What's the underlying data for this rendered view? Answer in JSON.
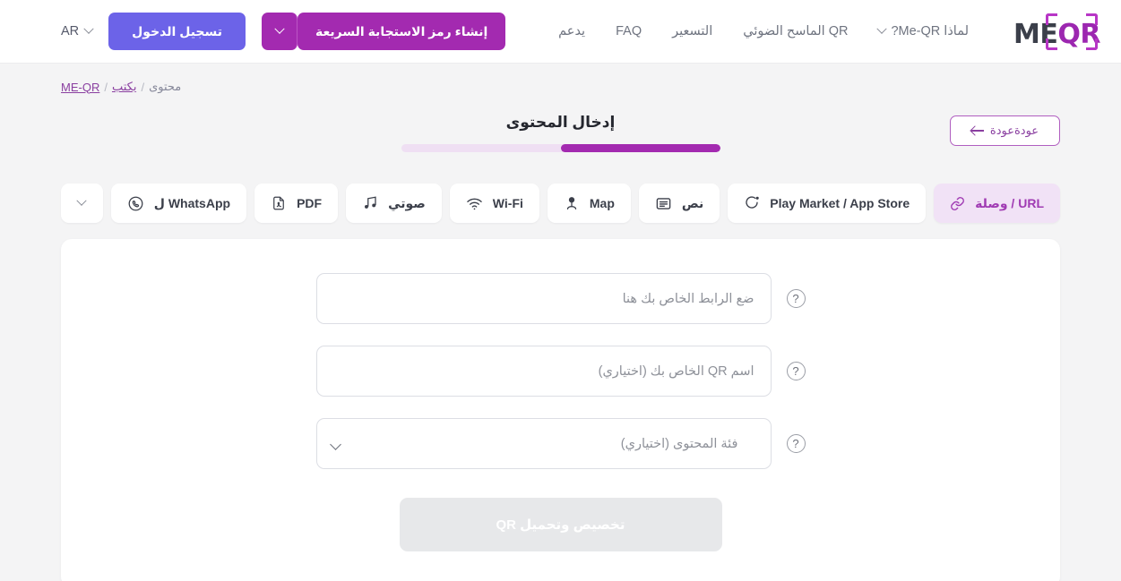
{
  "header": {
    "logo": {
      "primary": "ME",
      "accent": "QR",
      "alt": "ME-QR logo"
    },
    "nav": [
      {
        "label": "لماذا Me-QR?",
        "has_dropdown": true
      },
      {
        "label": "QR الماسح الضوئي",
        "has_dropdown": false
      },
      {
        "label": "التسعير",
        "has_dropdown": false
      },
      {
        "label": "FAQ",
        "has_dropdown": false
      },
      {
        "label": "يدعم",
        "has_dropdown": false
      }
    ],
    "create_qr_button": "إنشاء رمز الاستجابة السريعة",
    "login_button": "تسجيل الدخول",
    "language": "AR"
  },
  "breadcrumb": {
    "root": "ME-QR",
    "sep": "/",
    "middle": "يكتب",
    "current": "محتوى"
  },
  "step": {
    "back_button": "عودةعودة",
    "title": "إدخال المحتوى",
    "progress_percent": 50
  },
  "tabs": [
    {
      "label": "URL / وصلة",
      "icon": "link-icon",
      "active": true
    },
    {
      "label": "Play Market / App Store",
      "icon": "app-store-icon",
      "active": false
    },
    {
      "label": "نص",
      "icon": "text-icon",
      "active": false
    },
    {
      "label": "Map",
      "icon": "map-pin-icon",
      "active": false
    },
    {
      "label": "Wi-Fi",
      "icon": "wifi-icon",
      "active": false
    },
    {
      "label": "صوتي",
      "icon": "music-note-icon",
      "active": false
    },
    {
      "label": "PDF",
      "icon": "pdf-file-icon",
      "active": false
    },
    {
      "label": "WhatsApp ل",
      "icon": "whatsapp-icon",
      "active": false
    }
  ],
  "form": {
    "url_field": {
      "value": "",
      "placeholder": "ضع الرابط الخاص بك هنا"
    },
    "name_field": {
      "value": "",
      "placeholder": "اسم QR الخاص بك (اختياري)"
    },
    "category_select": {
      "value": "فئة المحتوى (اختياري)"
    },
    "help_symbol": "?",
    "submit_button": "تخصيص وتحميل QR"
  },
  "colors": {
    "brand_purple": "#a32ab0",
    "login_indigo": "#6c63e8",
    "active_tab_bg": "#f1e2f6",
    "active_tab_text": "#a03bb3",
    "page_bg": "#f4f4f5",
    "progress_track": "#efdff3"
  }
}
